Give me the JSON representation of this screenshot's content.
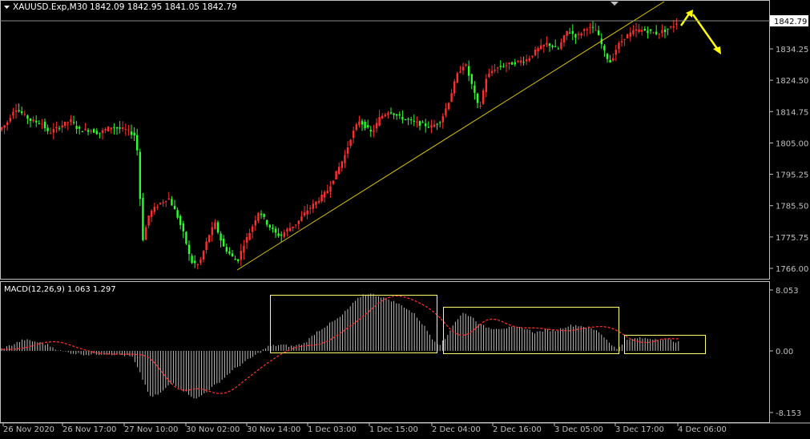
{
  "header": {
    "symbol_label": "XAUUSD.Exp,M30",
    "ohlc": "1842.09 1842.95 1841.05 1842.79"
  },
  "price_badge": "1842.79",
  "macd_header": "MACD(12,26,9) 1.063 1.297",
  "colors": {
    "background": "#000000",
    "axis": "#c0c0c0",
    "bull_candle": "#ff2d2d",
    "bear_candle": "#2bff2b",
    "trendline": "#d8c200",
    "arrows": "#ffff00",
    "macd_hist": "#bdbdbd",
    "macd_signal": "#ff2b2b",
    "highlight_box": "#ffff66"
  },
  "chart_data": [
    {
      "type": "candlestick",
      "symbol": "XAUUSD.Exp",
      "timeframe": "M30",
      "ylim": [
        1762.0,
        1848.0
      ],
      "y_ticks": [
        "1766.00",
        "1775.75",
        "1785.50",
        "1795.25",
        "1805.00",
        "1814.75",
        "1824.50",
        "1834.25"
      ],
      "x_ticks": [
        "26 Nov 2020",
        "26 Nov 17:00",
        "27 Nov 10:00",
        "30 Nov 02:00",
        "30 Nov 14:00",
        "1 Dec 03:00",
        "1 Dec 15:00",
        "2 Dec 04:00",
        "2 Dec 16:00",
        "3 Dec 05:00",
        "3 Dec 17:00",
        "4 Dec 06:00"
      ],
      "price_path": [
        [
          0,
          1809
        ],
        [
          10,
          1811
        ],
        [
          20,
          1816
        ],
        [
          30,
          1814
        ],
        [
          40,
          1812
        ],
        [
          55,
          1811
        ],
        [
          62,
          1808
        ],
        [
          75,
          1810
        ],
        [
          90,
          1812
        ],
        [
          100,
          1809
        ],
        [
          115,
          1809
        ],
        [
          125,
          1808
        ],
        [
          140,
          1810
        ],
        [
          160,
          1809
        ],
        [
          172,
          1807
        ],
        [
          176,
          1790
        ],
        [
          180,
          1775
        ],
        [
          188,
          1783
        ],
        [
          200,
          1786
        ],
        [
          212,
          1788
        ],
        [
          222,
          1783
        ],
        [
          232,
          1776
        ],
        [
          240,
          1768
        ],
        [
          250,
          1767
        ],
        [
          262,
          1776
        ],
        [
          270,
          1780
        ],
        [
          280,
          1773
        ],
        [
          290,
          1770
        ],
        [
          298,
          1768
        ],
        [
          305,
          1773
        ],
        [
          315,
          1778
        ],
        [
          325,
          1784
        ],
        [
          335,
          1780
        ],
        [
          345,
          1777
        ],
        [
          352,
          1776
        ],
        [
          360,
          1778
        ],
        [
          372,
          1780
        ],
        [
          385,
          1784
        ],
        [
          398,
          1787
        ],
        [
          410,
          1790
        ],
        [
          420,
          1795
        ],
        [
          432,
          1801
        ],
        [
          440,
          1807
        ],
        [
          450,
          1812
        ],
        [
          458,
          1810
        ],
        [
          466,
          1808
        ],
        [
          476,
          1813
        ],
        [
          488,
          1815
        ],
        [
          500,
          1813
        ],
        [
          512,
          1812
        ],
        [
          525,
          1811
        ],
        [
          540,
          1810
        ],
        [
          552,
          1812
        ],
        [
          562,
          1818
        ],
        [
          572,
          1826
        ],
        [
          582,
          1830
        ],
        [
          592,
          1822
        ],
        [
          600,
          1815
        ],
        [
          608,
          1825
        ],
        [
          618,
          1828
        ],
        [
          630,
          1829
        ],
        [
          645,
          1830
        ],
        [
          660,
          1831
        ],
        [
          672,
          1834
        ],
        [
          685,
          1836
        ],
        [
          698,
          1834
        ],
        [
          710,
          1840
        ],
        [
          722,
          1838
        ],
        [
          734,
          1841
        ],
        [
          746,
          1840
        ],
        [
          752,
          1836
        ],
        [
          758,
          1832
        ],
        [
          764,
          1830
        ],
        [
          772,
          1835
        ],
        [
          782,
          1838
        ],
        [
          795,
          1840
        ],
        [
          808,
          1840
        ],
        [
          820,
          1839
        ],
        [
          832,
          1840
        ],
        [
          840,
          1841
        ],
        [
          848,
          1842.79
        ]
      ],
      "current_price": 1842.79,
      "trendline": {
        "from": [
          "30 Nov 10:00",
          1767.0
        ],
        "to": [
          "4 Dec 00:00",
          1849.0
        ]
      },
      "annotations": [
        "trendline",
        "projection arrows: up then down"
      ]
    },
    {
      "type": "macd",
      "title": "MACD(12,26,9) 1.063 1.297",
      "ylim": [
        -8.153,
        8.053
      ],
      "y_ticks": [
        "8.053",
        "0.00",
        "-8.153"
      ],
      "histogram_path": [
        [
          0,
          0.2
        ],
        [
          15,
          0.8
        ],
        [
          30,
          1.5
        ],
        [
          45,
          1.2
        ],
        [
          60,
          0.8
        ],
        [
          75,
          0.0
        ],
        [
          90,
          -0.3
        ],
        [
          110,
          -0.5
        ],
        [
          130,
          -0.4
        ],
        [
          150,
          -0.5
        ],
        [
          165,
          -0.8
        ],
        [
          175,
          -3.0
        ],
        [
          188,
          -6.2
        ],
        [
          200,
          -5.6
        ],
        [
          215,
          -4.2
        ],
        [
          230,
          -5.3
        ],
        [
          245,
          -6.4
        ],
        [
          260,
          -5.2
        ],
        [
          275,
          -4.0
        ],
        [
          290,
          -2.6
        ],
        [
          305,
          -1.5
        ],
        [
          320,
          -0.5
        ],
        [
          335,
          0.6
        ],
        [
          350,
          0.8
        ],
        [
          365,
          0.6
        ],
        [
          380,
          1.0
        ],
        [
          395,
          2.5
        ],
        [
          410,
          3.5
        ],
        [
          425,
          4.5
        ],
        [
          440,
          6.2
        ],
        [
          452,
          7.4
        ],
        [
          460,
          7.6
        ],
        [
          475,
          7.2
        ],
        [
          490,
          6.6
        ],
        [
          505,
          5.8
        ],
        [
          518,
          4.8
        ],
        [
          530,
          3.2
        ],
        [
          540,
          1.6
        ],
        [
          548,
          0.8
        ],
        [
          556,
          1.6
        ],
        [
          566,
          3.6
        ],
        [
          578,
          5.0
        ],
        [
          588,
          4.6
        ],
        [
          600,
          3.4
        ],
        [
          612,
          3.0
        ],
        [
          625,
          3.0
        ],
        [
          640,
          3.1
        ],
        [
          655,
          3.0
        ],
        [
          668,
          2.4
        ],
        [
          682,
          2.8
        ],
        [
          695,
          2.7
        ],
        [
          708,
          3.3
        ],
        [
          720,
          3.4
        ],
        [
          735,
          3.1
        ],
        [
          748,
          2.5
        ],
        [
          760,
          1.2
        ],
        [
          770,
          0.2
        ],
        [
          780,
          1.3
        ],
        [
          795,
          1.7
        ],
        [
          815,
          1.6
        ],
        [
          835,
          1.5
        ],
        [
          848,
          1.1
        ]
      ],
      "signal_line": "red dotted, lagging histogram",
      "annotations": [
        "highlight box 1 Dec",
        "highlight box 2 Dec – 3 Dec",
        "highlight box 3 Dec 17:00 – 4 Dec"
      ]
    }
  ]
}
